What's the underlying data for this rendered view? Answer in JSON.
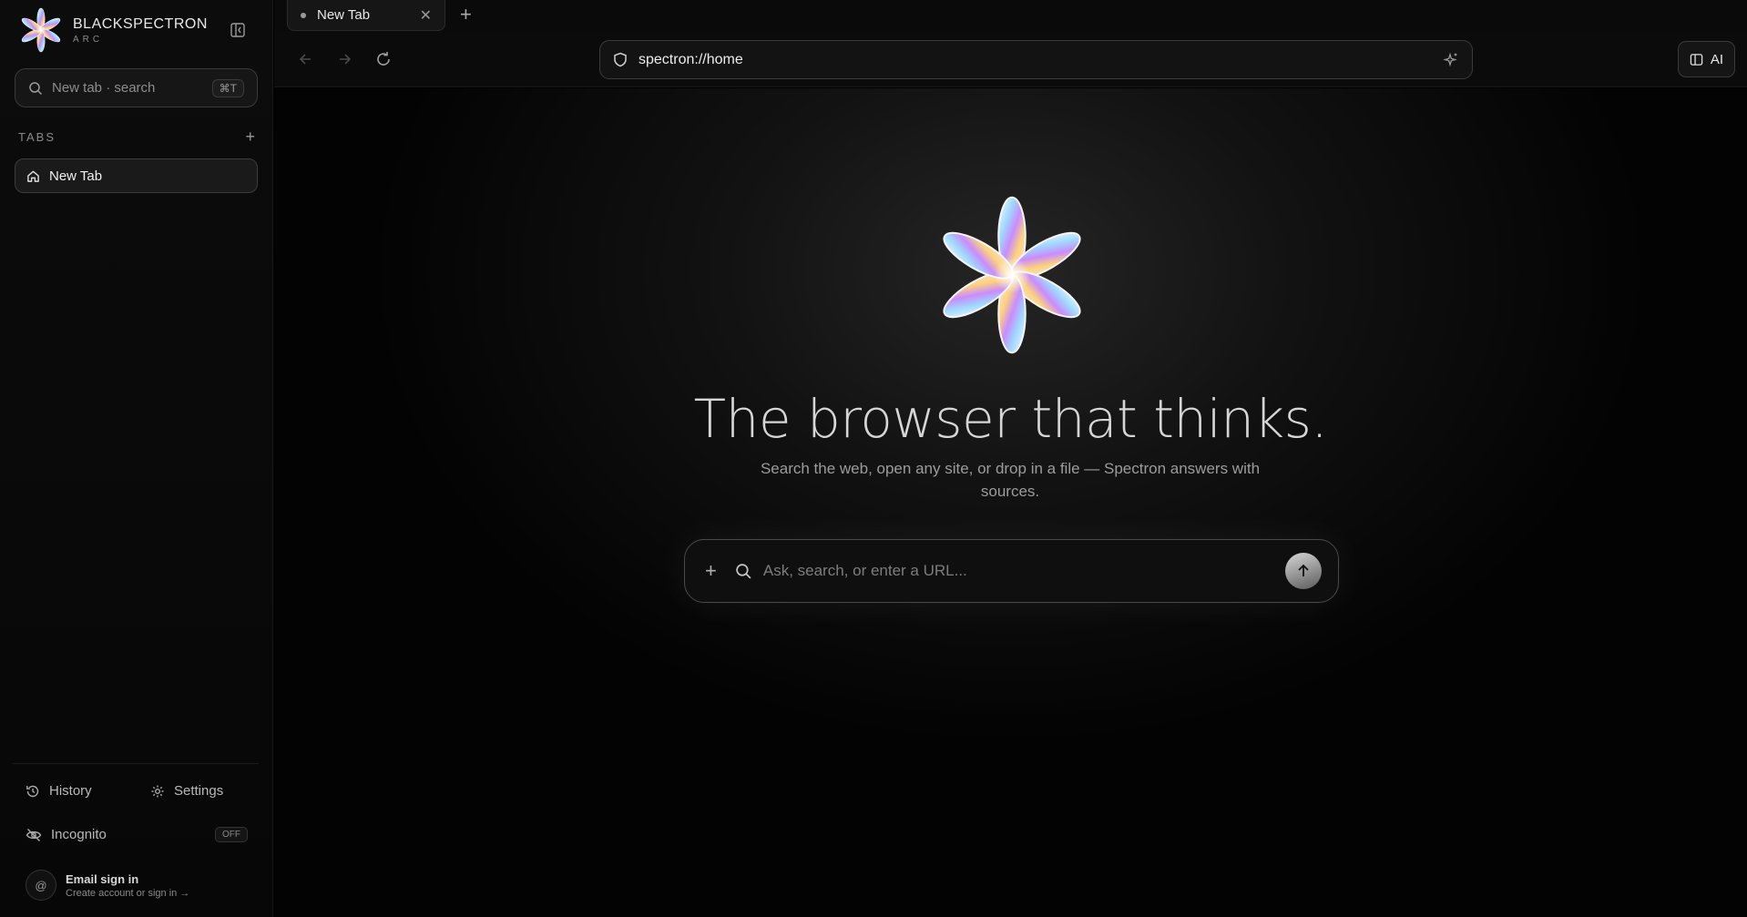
{
  "sidebar": {
    "brand_name": "BLACKSPECTRON",
    "brand_sub": "ARC",
    "search_placeholder": "New tab · search",
    "search_shortcut": "⌘T",
    "tabs_label": "TABS",
    "tabs": [
      {
        "label": "New Tab",
        "icon": "home-icon"
      }
    ],
    "history_label": "History",
    "settings_label": "Settings",
    "incognito_label": "Incognito",
    "incognito_state": "OFF",
    "account_avatar": "@",
    "account_title": "Email sign in",
    "account_sub": "Create account or sign in →"
  },
  "tabstrip": {
    "tabs": [
      {
        "label": "New Tab"
      }
    ]
  },
  "toolbar": {
    "url": "spectron://home",
    "ai_label": "AI"
  },
  "main": {
    "headline": "The browser that thinks.",
    "subline": "Search the web, open any site, or drop in a file — Spectron answers with sources.",
    "ask_placeholder": "Ask, search, or enter a URL..."
  },
  "colors": {
    "background": "#000000",
    "sidebar": "#0c0c0c",
    "border": "#3a3a3a",
    "text": "#e6e6e6"
  }
}
